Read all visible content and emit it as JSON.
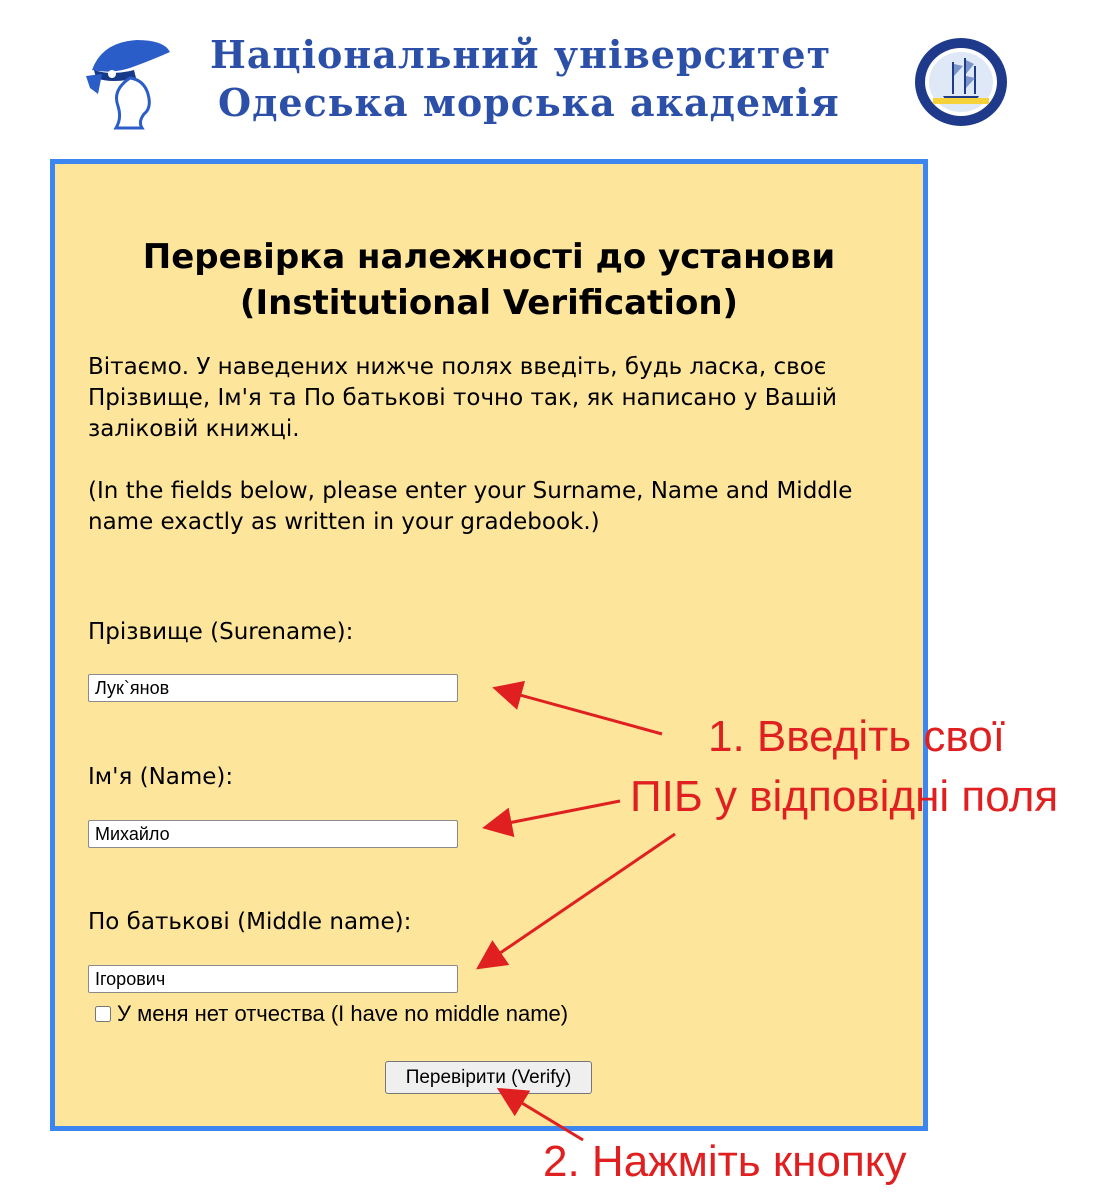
{
  "header": {
    "title_line1": "Національний університет",
    "title_line2": "Одеська морська академія",
    "logo_icon": "sailor-cap-logo-icon",
    "seal_icon": "academy-seal-icon",
    "title_color": "#2c4fa8"
  },
  "form": {
    "heading_line1": "Перевірка належності до установи",
    "heading_line2": "(Institutional Verification)",
    "intro_ua": "Вітаємо. У наведених нижче полях введіть, будь ласка, своє Прізвище, Ім'я та По батькові точно так, як написано у Вашій заліковій книжці.",
    "intro_en": "(In the fields below, please enter your Surname, Name and Middle name exactly as written in your gradebook.)",
    "surname_label": "Прізвище (Surename):",
    "surname_value": "Лук`янов",
    "name_label": "Ім'я (Name):",
    "name_value": "Михайло",
    "middle_label": "По батькові (Middle name):",
    "middle_value": "Ігорович",
    "no_middle_label": "У меня нет отчества (I have no middle name)",
    "no_middle_checked": false,
    "verify_label": "Перевірити (Verify)",
    "panel_bg": "#fde59b",
    "panel_border": "#3b86f0"
  },
  "annotations": {
    "step1_line1": "1. Введіть свої",
    "step1_line2": "ПІБ у відповідні поля",
    "step2": "2. Нажміть кнопку",
    "color": "#e02020"
  }
}
